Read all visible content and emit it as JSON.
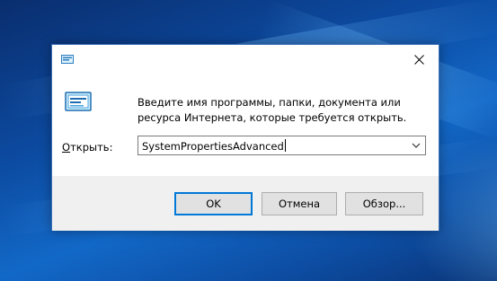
{
  "dialog": {
    "description": "Введите имя программы, папки, документа или ресурса Интернета, которые требуется открыть.",
    "open_label": "Открыть:",
    "open_label_accel": "О",
    "open_label_rest": "ткрыть:",
    "command_value": "SystemPropertiesAdvanced"
  },
  "buttons": {
    "ok": "OK",
    "cancel": "Отмена",
    "browse": "Обзор..."
  },
  "icons": {
    "title": "run-icon",
    "close": "close-icon",
    "large": "run-icon",
    "dropdown": "chevron-down-icon"
  },
  "colors": {
    "accent": "#0078d7",
    "footer": "#f0f0f0",
    "button_face": "#e1e1e1"
  }
}
